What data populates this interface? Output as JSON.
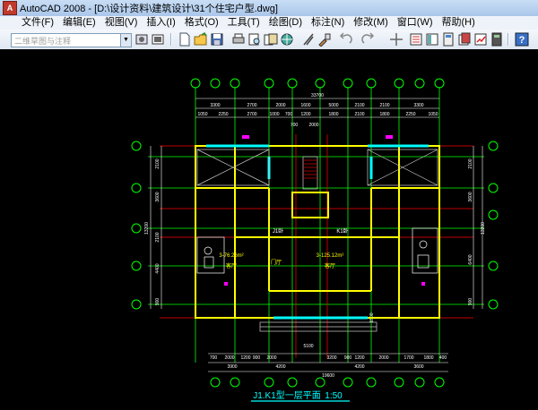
{
  "window": {
    "title": "AutoCAD 2008 - [D:\\设计资料\\建筑设计\\31个住宅户型.dwg]",
    "app_icon": "autocad-logo-icon"
  },
  "menu": [
    "文件(F)",
    "编辑(E)",
    "视图(V)",
    "插入(I)",
    "格式(O)",
    "工具(T)",
    "绘图(D)",
    "标注(N)",
    "修改(M)",
    "窗口(W)",
    "帮助(H)"
  ],
  "toolbar": {
    "workspace_placeholder": "二维草图与注释",
    "buttons": [
      "new-icon",
      "open-icon",
      "save-icon",
      "plot-icon",
      "plot-preview-icon",
      "publish-icon",
      "3d-dwf-icon",
      "cut-icon",
      "matchprop-icon",
      "undo-icon",
      "redo-icon",
      "properties-icon",
      "designcenter-icon",
      "toolpalettes-icon",
      "sheetset-icon",
      "markup-icon",
      "calculator-icon",
      "help-icon"
    ]
  },
  "drawing": {
    "title": "J1.K1型一层平面",
    "scale": "1:50",
    "overall_top": "33700",
    "overall_bottom": "19600",
    "top_row1": [
      "3300",
      "2700",
      "2000",
      "1600",
      "5000",
      "2100",
      "2100",
      "3300"
    ],
    "top_row2": [
      "1050",
      "2250",
      "2700",
      "1000",
      "700",
      "1200",
      "1800",
      "2100",
      "1800",
      "2250",
      "1050"
    ],
    "top_row3": [
      "700",
      "2000"
    ],
    "bottom_row1": [
      "700",
      "2000",
      "1200",
      "900",
      "2000",
      "3200",
      "900",
      "1200",
      "2000",
      "1700",
      "1800",
      "400"
    ],
    "bottom_row2": [
      "3900",
      "4200",
      "4200",
      "3600"
    ],
    "left_dims": [
      "2100",
      "3600",
      "2100",
      "4400",
      "900"
    ],
    "left_total": "13200",
    "right_dims": [
      "2100",
      "3600",
      "6400",
      "900"
    ],
    "right_total": "13200",
    "bottom_mid": "5100",
    "right_step": "1500",
    "rooms": [
      {
        "label": "J1卧",
        "color": "#ffffff"
      },
      {
        "label": "K1卧",
        "color": "#ffffff"
      },
      {
        "label": "3-76.26m²",
        "color": "#ffff00"
      },
      {
        "label": "3-125.12m²",
        "color": "#ffff00"
      },
      {
        "label": "客厅",
        "color": "#ffff00"
      },
      {
        "label": "门厅",
        "color": "#ffff00"
      },
      {
        "label": "客厅",
        "color": "#ffff00"
      }
    ]
  },
  "colors": {
    "axis": "#00ff00",
    "wall": "#ffff00",
    "dim": "#ffffff",
    "window": "#00ffff",
    "grid_red": "#ff0000",
    "furniture": "#ff00ff"
  }
}
